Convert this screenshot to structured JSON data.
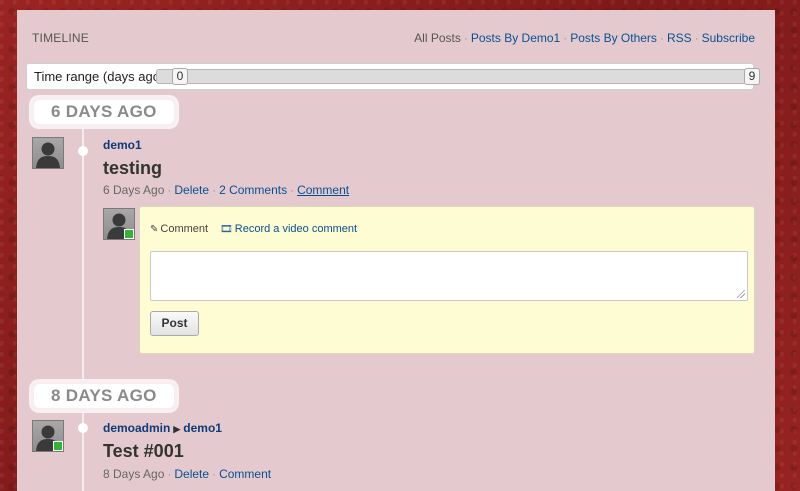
{
  "header": {
    "title": "TIMELINE",
    "filters": [
      "All Posts",
      "Posts By Demo1",
      "Posts By Others",
      "RSS",
      "Subscribe"
    ]
  },
  "time_range": {
    "label": "Time range (days ago):",
    "min": "0",
    "max": "9"
  },
  "groups": [
    {
      "day_label": "6 DAYS AGO",
      "post": {
        "author": "demo1",
        "title": "testing",
        "age": "6 Days Ago",
        "actions": [
          "Delete",
          "2 Comments",
          "Comment"
        ]
      }
    },
    {
      "day_label": "8 DAYS AGO",
      "post": {
        "author": "demoadmin",
        "recipient": "demo1",
        "title": "Test #001",
        "age": "8 Days Ago",
        "actions": [
          "Delete",
          "Comment"
        ]
      }
    }
  ],
  "comment_form": {
    "tab_comment": "Comment",
    "tab_video": "Record a video comment",
    "textarea_value": "",
    "submit_label": "Post"
  },
  "icons": {
    "comment_tab": "pencil-icon",
    "video_tab": "film-icon",
    "avatar": "user-silhouette-icon",
    "presence": "online-status-icon"
  },
  "colors": {
    "background": "#8e1f1e",
    "panel": "#e4cace",
    "link": "#0a4f91",
    "comment_box": "#fdfcd2",
    "online": "#36b337"
  }
}
